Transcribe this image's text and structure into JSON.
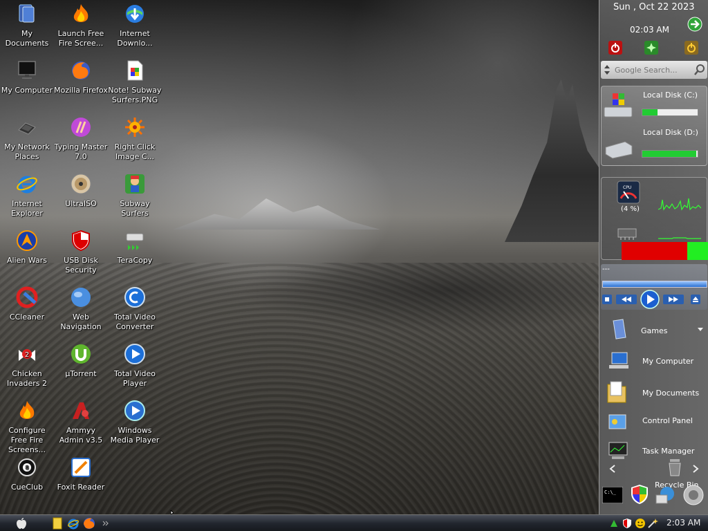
{
  "desktop_icons": [
    {
      "label": "My Documents",
      "icon": "my-documents-icon"
    },
    {
      "label": "Launch Free Fire Scree...",
      "icon": "fire-icon"
    },
    {
      "label": "Internet Downlo...",
      "icon": "internet-download-manager-icon"
    },
    {
      "label": "My Computer",
      "icon": "monitor-icon"
    },
    {
      "label": "Mozilla Firefox",
      "icon": "firefox-icon"
    },
    {
      "label": "Note! Subway Surfers.PNG",
      "icon": "image-file-icon"
    },
    {
      "label": "My Network Places",
      "icon": "network-places-icon"
    },
    {
      "label": "Typing Master 7.0",
      "icon": "typing-master-icon"
    },
    {
      "label": "Right Click Image C...",
      "icon": "sun-gear-icon"
    },
    {
      "label": "Internet Explorer",
      "icon": "internet-explorer-icon"
    },
    {
      "label": "UltraISO",
      "icon": "disc-icon"
    },
    {
      "label": "Subway Surfers",
      "icon": "subway-surfers-icon"
    },
    {
      "label": "Alien Wars",
      "icon": "alien-wars-icon"
    },
    {
      "label": "USB Disk Security",
      "icon": "shield-icon"
    },
    {
      "label": "TeraCopy",
      "icon": "drive-copy-icon"
    },
    {
      "label": "CCleaner",
      "icon": "ccleaner-icon"
    },
    {
      "label": "Web Navigation",
      "icon": "globe-icon"
    },
    {
      "label": "Total Video Converter",
      "icon": "video-converter-icon"
    },
    {
      "label": "Chicken Invaders 2",
      "icon": "chicken-icon"
    },
    {
      "label": "µTorrent",
      "icon": "utorrent-icon"
    },
    {
      "label": "Total Video Player",
      "icon": "video-player-icon"
    },
    {
      "label": "Configure Free Fire Screens...",
      "icon": "fire-icon"
    },
    {
      "label": "Ammyy Admin v3.5",
      "icon": "ammyy-admin-icon"
    },
    {
      "label": "Windows Media Player",
      "icon": "media-player-icon"
    },
    {
      "label": "CueClub",
      "icon": "cueclub-icon"
    },
    {
      "label": "Foxit Reader",
      "icon": "foxit-reader-icon"
    }
  ],
  "sidebar": {
    "date": "Sun , Oct 22 2023",
    "time": "02:03 AM",
    "search_placeholder": "Google Search...",
    "drives": [
      {
        "label": "Local Disk (C:)",
        "used_fraction": 0.28,
        "color": "#22cc33"
      },
      {
        "label": "Local Disk (D:)",
        "used_fraction": 0.98,
        "color": "#22cc33"
      }
    ],
    "cpu_text": "(4 %)",
    "cpu_label": "CPU",
    "memory_bar": {
      "used_fraction": 0.75,
      "used_color": "#e00000",
      "free_color": "#22ee22"
    },
    "player_title": "---",
    "shortcuts": [
      {
        "label": "Games",
        "icon": "games-folder-icon"
      },
      {
        "label": "My Computer",
        "icon": "my-computer-icon"
      },
      {
        "label": "My Documents",
        "icon": "my-documents-folder-icon"
      },
      {
        "label": "Control Panel",
        "icon": "control-panel-icon"
      },
      {
        "label": "Task Manager",
        "icon": "task-manager-icon"
      },
      {
        "label": "Recycle Bin",
        "icon": "recycle-bin-icon"
      }
    ]
  },
  "taskbar": {
    "clock": "2:03 AM"
  },
  "colors": {
    "accent_blue": "#1e6fe0",
    "gauge_green": "#22cc33"
  }
}
